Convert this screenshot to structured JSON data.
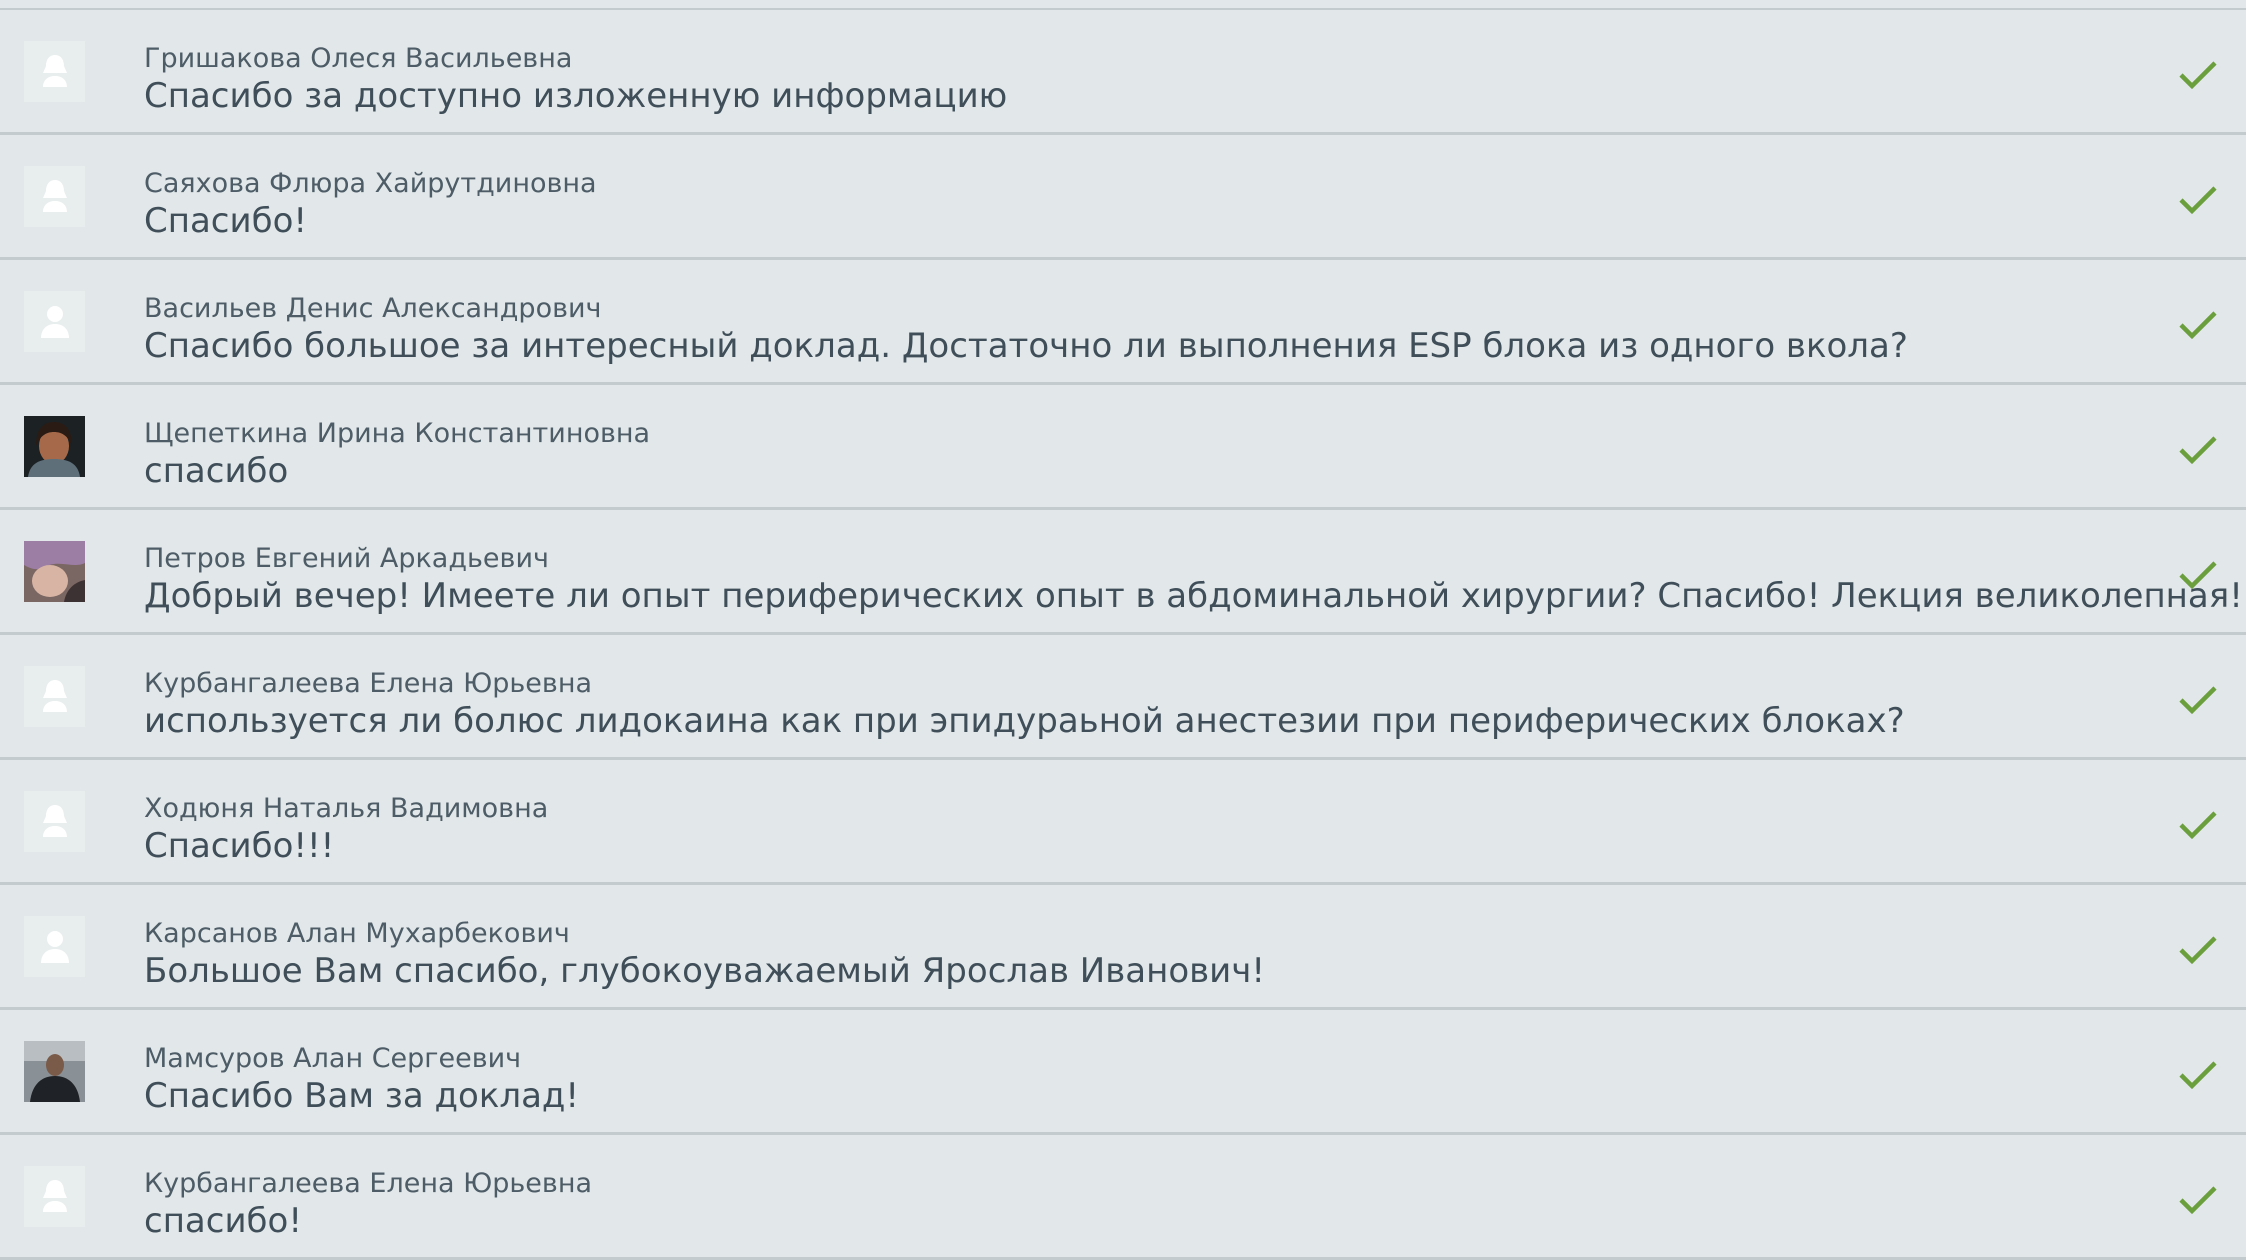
{
  "comments": [
    {
      "author": "Гришакова Олеся Васильевна",
      "message": "Спасибо за доступно изложенную информацию",
      "avatar": "female-silhouette-icon"
    },
    {
      "author": "Саяхова Флюра Хайрутдиновна",
      "message": "Спасибо!",
      "avatar": "female-silhouette-icon"
    },
    {
      "author": "Васильев Денис Александрович",
      "message": "Спасибо большое за интересный доклад. Достаточно ли выполнения ESP блока из одного вкола?",
      "avatar": "male-silhouette-icon"
    },
    {
      "author": "Щепеткина Ирина Константиновна",
      "message": "спасибо",
      "avatar": "user-photo"
    },
    {
      "author": "Петров Евгений Аркадьевич",
      "message": "Добрый вечер! Имеете ли опыт периферических опыт в абдоминальной хирургии? Спасибо! Лекция великолепная!",
      "avatar": "user-photo"
    },
    {
      "author": "Курбангалеева Елена Юрьевна",
      "message": "используется ли болюс лидокаина как при эпидураьной анестезии при периферических блоках?",
      "avatar": "female-silhouette-icon"
    },
    {
      "author": "Ходюня Наталья Вадимовна",
      "message": "Спасибо!!!",
      "avatar": "female-silhouette-icon"
    },
    {
      "author": "Карсанов Алан Мухарбекович",
      "message": "Большое Вам спасибо, глубокоуважаемый Ярослав Иванович!",
      "avatar": "male-silhouette-icon"
    },
    {
      "author": "Мамсуров Алан Сергеевич",
      "message": "Спасибо Вам за доклад!",
      "avatar": "user-photo"
    },
    {
      "author": "Курбангалеева Елена Юрьевна",
      "message": "спасибо!",
      "avatar": "female-silhouette-icon"
    }
  ],
  "colors": {
    "background": "#e2e8ea",
    "divider": "#c3cbce",
    "check": "#6b9e3c",
    "author_text": "#4d5c66",
    "message_text": "#3f4e59"
  },
  "icons": {
    "approved": "checkmark-icon"
  }
}
